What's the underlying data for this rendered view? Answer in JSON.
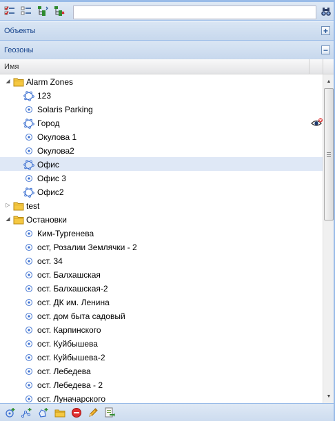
{
  "toolbar": {
    "buttons": [
      {
        "icon": "check-list-icon"
      },
      {
        "icon": "uncheck-list-icon"
      },
      {
        "icon": "tree-expand-icon"
      },
      {
        "icon": "tree-collapse-icon"
      }
    ],
    "search_value": "",
    "find_icon": "binoculars-icon"
  },
  "panels": {
    "objects": {
      "title": "Объекты",
      "tool": "+"
    },
    "geozones": {
      "title": "Геозоны",
      "tool": "−"
    }
  },
  "grid": {
    "column_name": "Имя"
  },
  "tree": [
    {
      "label": "Alarm Zones",
      "type": "folder",
      "level": 0,
      "expanded": true
    },
    {
      "label": "123",
      "type": "polygon",
      "level": 1
    },
    {
      "label": "Solaris Parking",
      "type": "circle",
      "level": 1
    },
    {
      "label": "Город",
      "type": "polygon",
      "level": 1,
      "badge": "eye-hidden-icon"
    },
    {
      "label": "Окулова 1",
      "type": "circle",
      "level": 1
    },
    {
      "label": "Окулова2",
      "type": "circle",
      "level": 1
    },
    {
      "label": "Офис",
      "type": "polygon",
      "level": 1,
      "selected": true
    },
    {
      "label": "Офис 3",
      "type": "circle",
      "level": 1
    },
    {
      "label": "Офис2",
      "type": "polygon",
      "level": 1
    },
    {
      "label": "test",
      "type": "folder",
      "level": 0,
      "expanded": false
    },
    {
      "label": "Остановки",
      "type": "folder",
      "level": 0,
      "expanded": true
    },
    {
      "label": "Ким-Тургенева",
      "type": "circle",
      "level": 1
    },
    {
      "label": "ост, Розалии Землячки - 2",
      "type": "circle",
      "level": 1
    },
    {
      "label": "ост. 34",
      "type": "circle",
      "level": 1
    },
    {
      "label": "ост. Балхашская",
      "type": "circle",
      "level": 1
    },
    {
      "label": "ост. Балхашская-2",
      "type": "circle",
      "level": 1
    },
    {
      "label": "ост. ДК им. Ленина",
      "type": "circle",
      "level": 1
    },
    {
      "label": "ост. дом быта садовый",
      "type": "circle",
      "level": 1
    },
    {
      "label": "ост. Карпинского",
      "type": "circle",
      "level": 1
    },
    {
      "label": "ост. Куйбышева",
      "type": "circle",
      "level": 1
    },
    {
      "label": "ост. Куйбышева-2",
      "type": "circle",
      "level": 1
    },
    {
      "label": "ост. Лебедева",
      "type": "circle",
      "level": 1
    },
    {
      "label": "ост. Лебедева - 2",
      "type": "circle",
      "level": 1
    },
    {
      "label": "ост. Луначарского",
      "type": "circle",
      "level": 1
    }
  ],
  "bottom_toolbar": {
    "buttons": [
      {
        "icon": "add-circle-zone-icon"
      },
      {
        "icon": "add-line-zone-icon"
      },
      {
        "icon": "add-polygon-zone-icon"
      },
      {
        "icon": "add-folder-icon"
      },
      {
        "icon": "delete-icon"
      },
      {
        "icon": "edit-pencil-icon"
      },
      {
        "icon": "export-icon"
      }
    ]
  },
  "colors": {
    "accent": "#99bbe8",
    "header_text": "#15428b",
    "selection": "#dfe8f6",
    "folder": "#f5c842",
    "zone_blue": "#3b6fd0"
  }
}
